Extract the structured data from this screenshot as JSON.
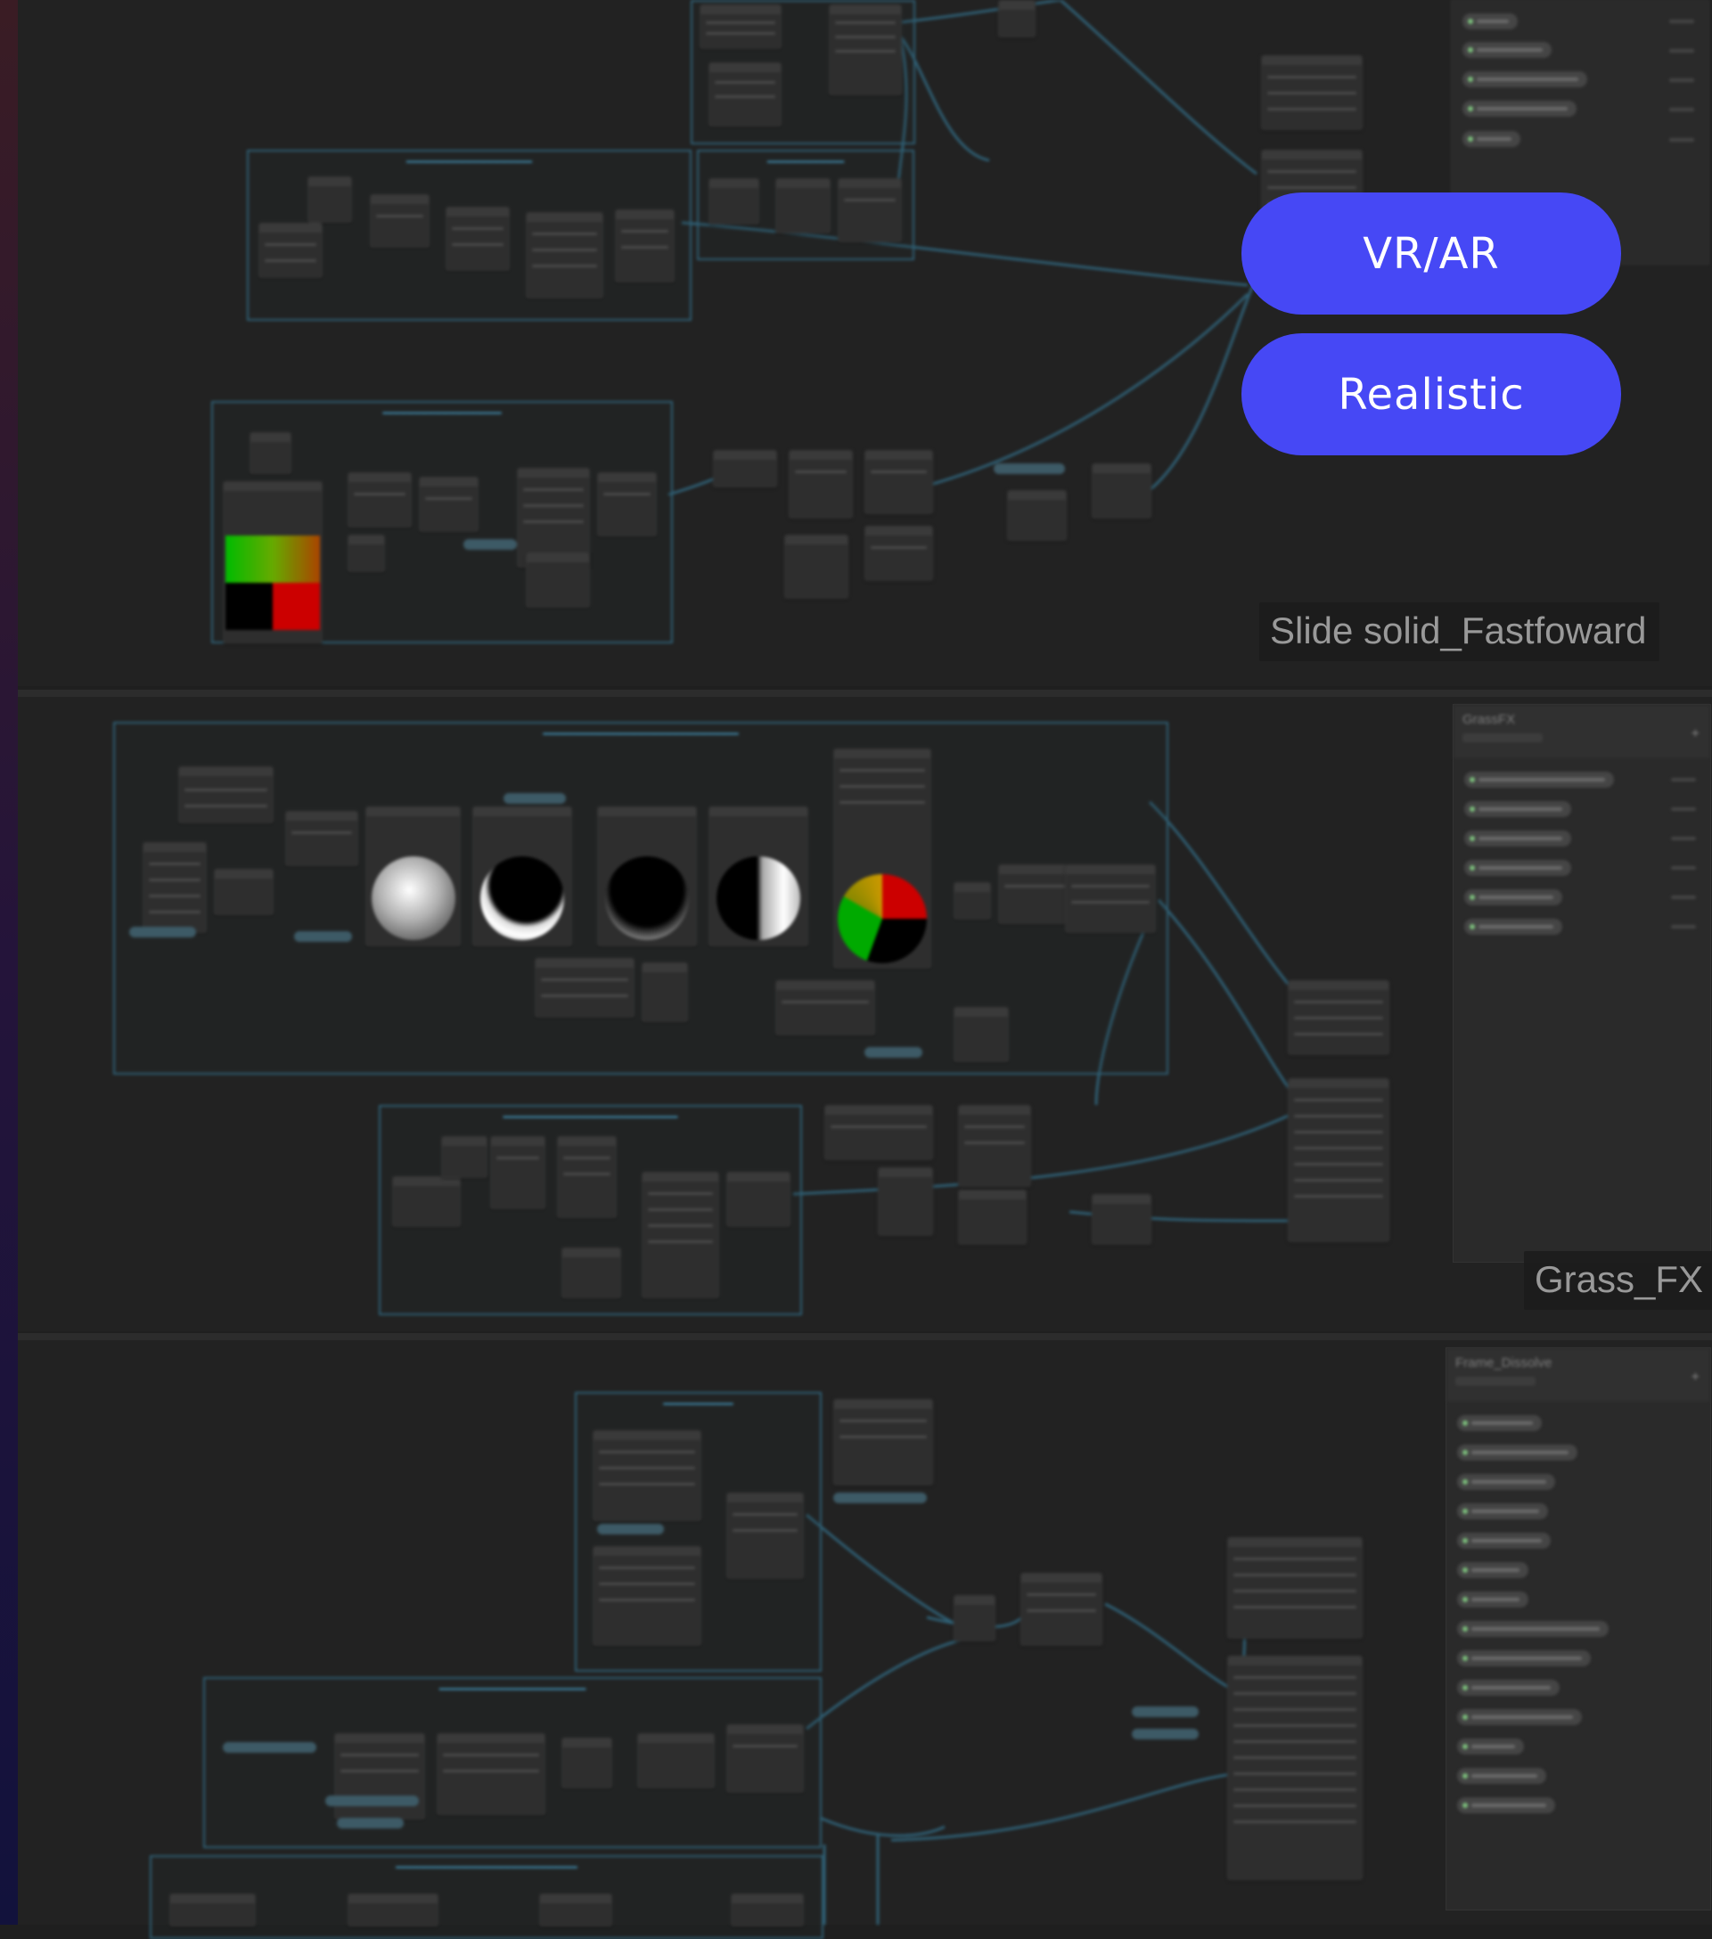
{
  "panels": {
    "slide_solid": {
      "label": "Slide solid_Fastfoward",
      "properties_title": ""
    },
    "grass_fx": {
      "label": "Grass_FX",
      "properties_title": "GrassFX"
    },
    "frame_dissolve": {
      "label": "",
      "properties_title": "Frame_Dissolve"
    }
  },
  "tags": [
    {
      "label": "VR/AR"
    },
    {
      "label": "Realistic"
    }
  ],
  "colors": {
    "tag_background": "#4648f5",
    "tag_text": "#ffffff",
    "canvas_background": "#1f1f1f",
    "wire": "#2f5f74"
  },
  "icons": {
    "add_property": "plus-icon"
  }
}
